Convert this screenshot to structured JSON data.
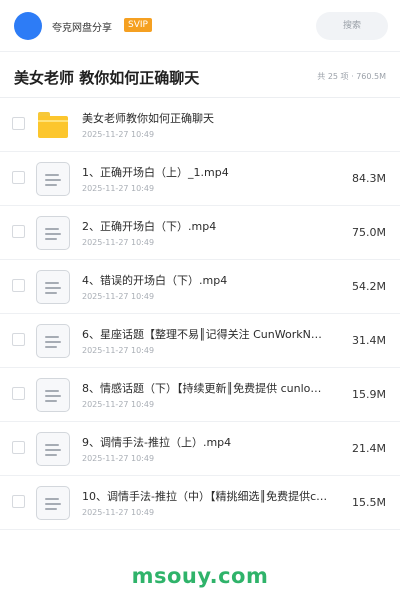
{
  "app": {
    "title": "夸克网盘分享",
    "badge": "SVIP"
  },
  "search": {
    "label": "搜索"
  },
  "folder": {
    "title": "美女老师 教你如何正确聊天",
    "summary": "共 25 项 · 760.5M"
  },
  "files": [
    {
      "name": "美女老师教你如何正确聊天",
      "date": "2025-11-27 10:49",
      "size": "",
      "type": "folder"
    },
    {
      "name": "1、正确开场白（上）_1.mp4",
      "date": "2025-11-27 10:49",
      "size": "84.3M",
      "type": "video"
    },
    {
      "name": "2、正确开场白（下）.mp4",
      "date": "2025-11-27 10:49",
      "size": "75.0M",
      "type": "video"
    },
    {
      "name": "4、错误的开场白（下）.mp4",
      "date": "2025-11-27 10:49",
      "size": "54.2M",
      "type": "video"
    },
    {
      "name": "6、星座话题【整理不易║记得关注 CunWorkN…",
      "date": "2025-11-27 10:49",
      "size": "31.4M",
      "type": "video"
    },
    {
      "name": "8、情感话题（下）【持续更新║免费提供 cunlo…",
      "date": "2025-11-27 10:49",
      "size": "15.9M",
      "type": "video"
    },
    {
      "name": "9、调情手法-推拉（上）.mp4",
      "date": "2025-11-27 10:49",
      "size": "21.4M",
      "type": "video"
    },
    {
      "name": "10、调情手法-推拉（中）【精挑细选║免费提供c…",
      "date": "2025-11-27 10:49",
      "size": "15.5M",
      "type": "video"
    }
  ],
  "watermark": "msouy.com"
}
